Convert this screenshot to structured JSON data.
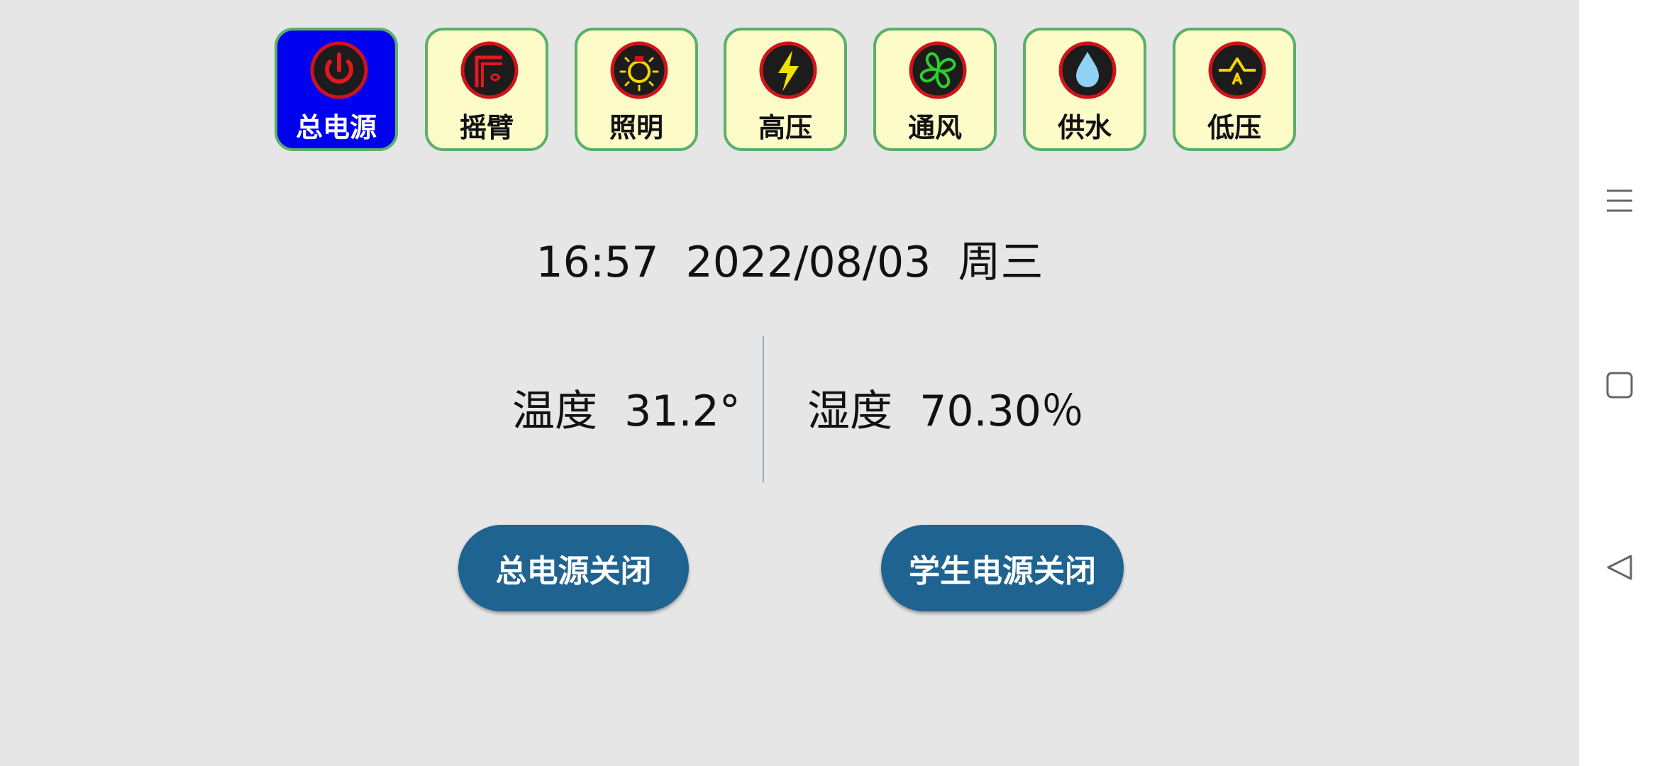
{
  "tiles": [
    {
      "label": "总电源",
      "icon": "power-icon",
      "active": true
    },
    {
      "label": "摇臂",
      "icon": "rocker-arm-icon",
      "active": false
    },
    {
      "label": "照明",
      "icon": "bulb-icon",
      "active": false
    },
    {
      "label": "高压",
      "icon": "lightning-icon",
      "active": false
    },
    {
      "label": "通风",
      "icon": "fan-icon",
      "active": false
    },
    {
      "label": "供水",
      "icon": "water-drop-icon",
      "active": false
    },
    {
      "label": "低压",
      "icon": "low-voltage-icon",
      "active": false
    }
  ],
  "status": {
    "datetime": "16:57  2022/08/03  周三",
    "temperature": "温度  31.2°",
    "humidity": "湿度  70.30％"
  },
  "actions": {
    "main_power_off": "总电源关闭",
    "student_power_off": "学生电源关闭"
  },
  "nav": {
    "icons": [
      "menu-icon",
      "home-square-icon",
      "back-triangle-icon"
    ]
  },
  "colors": {
    "background": "#e6e6e6",
    "tile_background": "#fdfcc9",
    "tile_border": "#5ab06a",
    "tile_active": "#0000f0",
    "icon_ring": "#d0131b",
    "button": "#1f6390"
  }
}
